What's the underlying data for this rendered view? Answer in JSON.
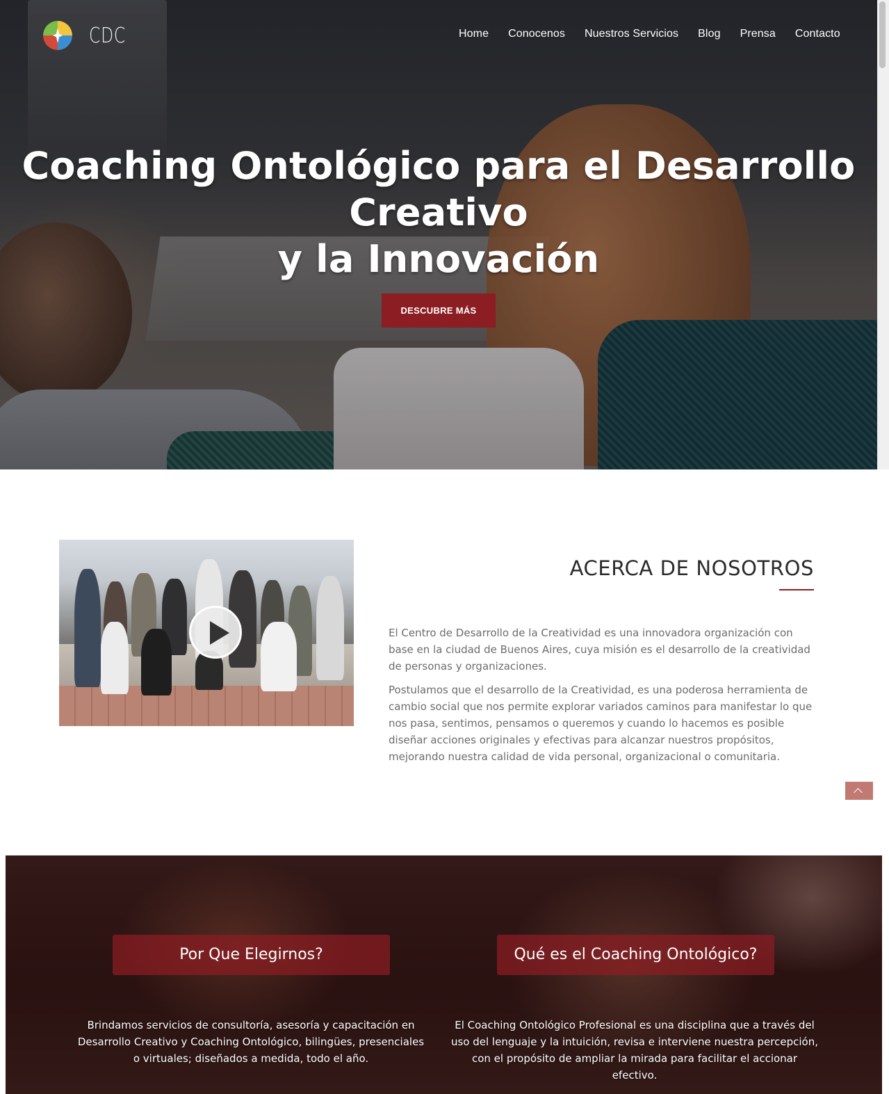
{
  "brand": {
    "name": "CDC"
  },
  "nav": {
    "items": [
      "Home",
      "Conocenos",
      "Nuestros Servicios",
      "Blog",
      "Prensa",
      "Contacto"
    ]
  },
  "hero": {
    "title_line1": "Coaching Ontológico para el Desarrollo Creativo",
    "title_line2": "y la Innovación",
    "button_label": "DESCUBRE MÁS"
  },
  "about": {
    "title": "ACERCA DE NOSOTROS",
    "paragraph1": "El Centro de Desarrollo de la Creatividad es una innovadora organización con base en la ciudad de Buenos Aires, cuya misión es el desarrollo de la creatividad de personas y organizaciones.",
    "paragraph2": "Postulamos que el desarrollo de la Creatividad, es una poderosa herramienta de cambio social que nos permite explorar variados caminos para manifestar lo que nos pasa, sentimos, pensamos o queremos y cuando lo hacemos es posible diseñar acciones originales y efectivas para alcanzar nuestros propósitos, mejorando nuestra calidad de vida personal, organizacional o comunitaria."
  },
  "features": {
    "items": [
      {
        "heading": "Por Que Elegirnos?",
        "text": "Brindamos servicios de consultoría, asesoría y capacitación en Desarrollo Creativo y Coaching Ontológico, bilingües, presenciales o virtuales; diseñados a medida, todo el año."
      },
      {
        "heading": "Qué es el Coaching Ontológico?",
        "text": "El Coaching Ontológico Profesional es una disciplina que a través del uso del lenguaje y la intuición, revisa e interviene nuestra percepción, con el propósito de ampliar la mirada para facilitar el accionar efectivo."
      }
    ]
  },
  "colors": {
    "accent": "#8c1d22",
    "back_to_top": "#c07a72"
  },
  "icons": {
    "logo": "star-circle-logo-icon",
    "play": "play-icon",
    "back_to_top": "chevron-up-icon"
  }
}
